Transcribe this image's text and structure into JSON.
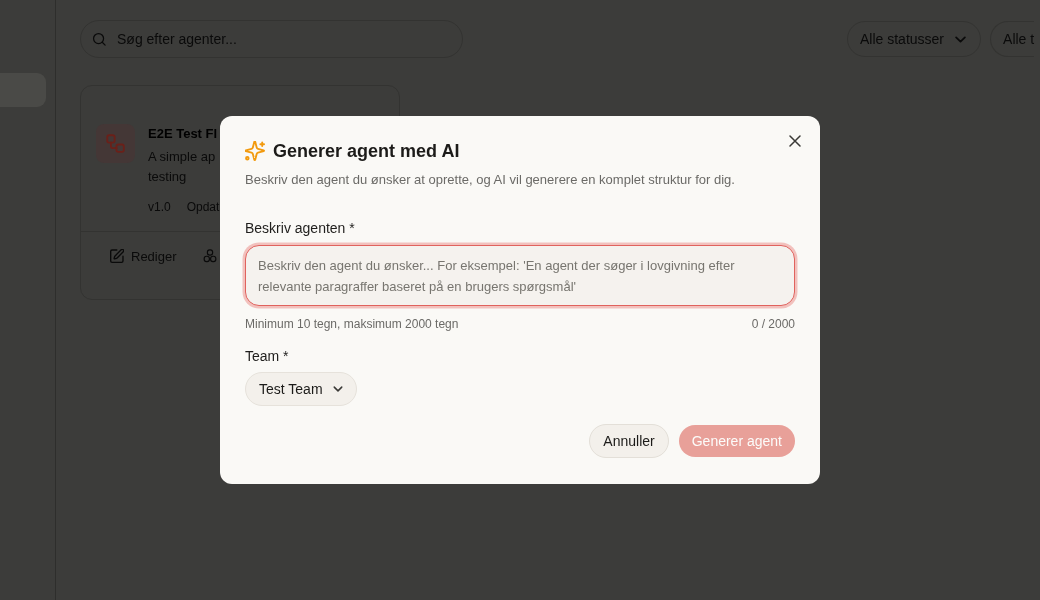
{
  "search": {
    "placeholder": "Søg efter agenter..."
  },
  "filters": [
    {
      "label": "Alle statusser",
      "cut_off": false
    },
    {
      "label": "Alle t",
      "cut_off": true
    }
  ],
  "agent_card": {
    "title": "E2E Test Fl",
    "description": "A simple ap testing",
    "meta": [
      "v1.0",
      "Opdat"
    ],
    "edit_action": {
      "label": "Rediger"
    }
  },
  "dialog": {
    "title": "Generer agent med AI",
    "subtitle": "Beskriv den agent du ønsker at oprette, og AI vil generere en komplet struktur for dig.",
    "description_field": {
      "label": "Beskriv agenten *",
      "placeholder": "Beskriv den agent du ønsker... For eksempel: 'En agent der søger i lovgivning efter relevante paragraffer baseret på en brugers spørgsmål'",
      "invalid": true,
      "hint": "Minimum 10 tegn, maksimum 2000 tegn",
      "counter": "0 / 2000"
    },
    "team_field": {
      "label": "Team *",
      "value": "Test Team"
    },
    "buttons": [
      {
        "label": "Annuller",
        "kind": "secondary",
        "disabled": false
      },
      {
        "label": "Generer agent",
        "kind": "primary",
        "disabled": true
      }
    ]
  }
}
